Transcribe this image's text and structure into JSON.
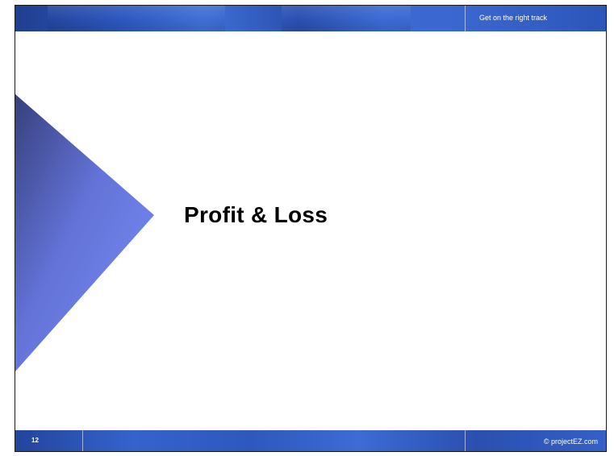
{
  "header": {
    "tagline": "Get on the right track"
  },
  "main": {
    "title": "Profit & Loss"
  },
  "footer": {
    "page_number": "12",
    "copyright": "© projectEZ.com"
  },
  "colors": {
    "bar_blue": "#2d57bf",
    "arrow_dark": "#3c4a8c",
    "arrow_light": "#7a8cf5",
    "title_text": "#000000"
  }
}
